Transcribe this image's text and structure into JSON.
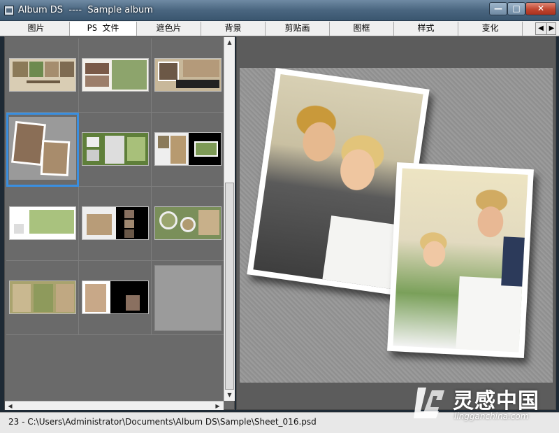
{
  "window": {
    "title": "Album DS  ----  Sample album",
    "minimize_label": "—",
    "maximize_label": "□",
    "close_label": "✕"
  },
  "tabs": [
    {
      "label": "图片",
      "active": false
    },
    {
      "label": "PS 文件",
      "active": true
    },
    {
      "label": "遮色片",
      "active": false
    },
    {
      "label": "背景",
      "active": false
    },
    {
      "label": "剪贴画",
      "active": false
    },
    {
      "label": "图框",
      "active": false
    },
    {
      "label": "样式",
      "active": false
    },
    {
      "label": "变化",
      "active": false
    }
  ],
  "tab_scroll": {
    "left": "◀",
    "right": "▶"
  },
  "thumbnails": {
    "selected_index": 3,
    "empty_index": 11,
    "count": 12
  },
  "status": {
    "path": "23 - C:\\Users\\Administrator\\Documents\\Album DS\\Sample\\Sheet_016.psd"
  },
  "watermark": {
    "brand": "灵感中国",
    "url": "lingganchina.com"
  },
  "colors": {
    "selection": "#3a8fe0",
    "panel": "#6a6a6a",
    "close_button": "#c0452f"
  }
}
